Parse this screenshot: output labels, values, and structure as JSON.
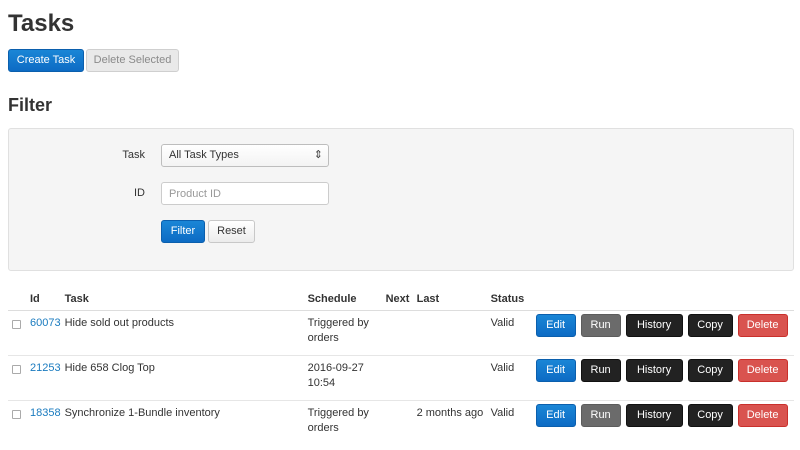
{
  "page": {
    "title": "Tasks"
  },
  "toolbar": {
    "create_label": "Create Task",
    "delete_selected_label": "Delete Selected"
  },
  "filter": {
    "title": "Filter",
    "task_label": "Task",
    "task_selected": "All Task Types",
    "id_label": "ID",
    "id_placeholder": "Product ID",
    "id_value": "",
    "filter_button": "Filter",
    "reset_button": "Reset"
  },
  "table": {
    "headers": {
      "id": "Id",
      "task": "Task",
      "schedule": "Schedule",
      "next": "Next",
      "last": "Last",
      "status": "Status"
    },
    "rows": [
      {
        "id": "60073",
        "task": "Hide sold out products",
        "schedule": "Triggered by orders",
        "next": "",
        "last": "",
        "status": "Valid",
        "run_disabled": true
      },
      {
        "id": "21253",
        "task": "Hide 658 Clog Top",
        "schedule": "2016-09-27 10:54",
        "next": "",
        "last": "",
        "status": "Valid",
        "run_disabled": false
      },
      {
        "id": "18358",
        "task": "Synchronize 1-Bundle inventory",
        "schedule": "Triggered by orders",
        "next": "",
        "last": "2 months ago",
        "status": "Valid",
        "run_disabled": true
      }
    ],
    "actions": {
      "edit": "Edit",
      "run": "Run",
      "history": "History",
      "copy": "Copy",
      "delete": "Delete"
    }
  },
  "colors": {
    "primary": "#0d6bc4",
    "link": "#1a7bbf",
    "danger": "#d9534f",
    "dark": "#222222",
    "disabled_run": "#6b6b6b"
  },
  "icons": {
    "select_arrow": "updown-chevron-icon"
  }
}
